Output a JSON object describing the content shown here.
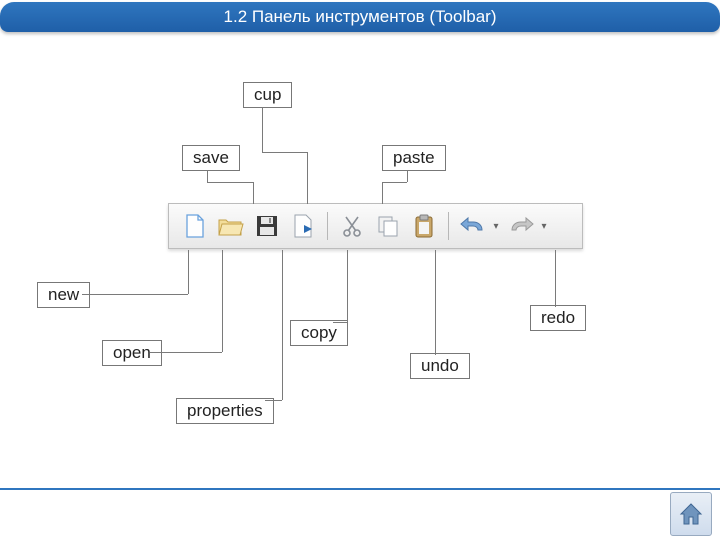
{
  "title": "1.2 Панель инструментов (Toolbar)",
  "labels": {
    "new": "new",
    "open": "open",
    "save": "save",
    "properties": "properties",
    "cup": "cup",
    "copy": "copy",
    "paste": "paste",
    "undo": "undo",
    "redo": "redo"
  },
  "icons": {
    "new": "new-file-icon",
    "open": "open-folder-icon",
    "save": "save-disk-icon",
    "properties": "properties-icon",
    "cut": "scissors-icon",
    "copy": "copy-icon",
    "paste": "clipboard-icon",
    "undo": "undo-arrow-icon",
    "redo": "redo-arrow-icon",
    "dropdown": "chevron-down-icon",
    "home": "home-icon"
  }
}
